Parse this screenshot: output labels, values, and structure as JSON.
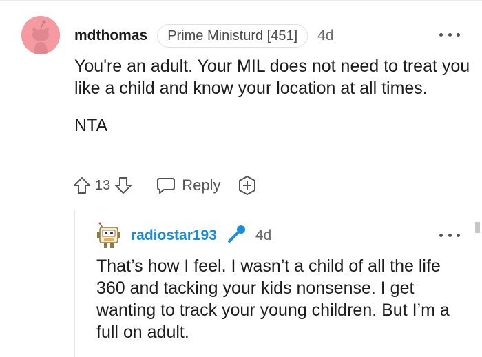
{
  "comment": {
    "author": "mdthomas",
    "flair": "Prime Ministurd [451]",
    "age": "4d",
    "paragraphs": [
      "You're an adult. Your MIL does not need to treat you like a child and know your location at all times.",
      "NTA"
    ],
    "vote_count": "13",
    "reply_label": "Reply",
    "icons": {
      "avatar": "snoo-avatar",
      "more": "more-options-icon",
      "upvote": "upvote-arrow-icon",
      "downvote": "downvote-arrow-icon",
      "reply": "speech-bubble-icon",
      "award": "award-plus-icon"
    },
    "avatar_bg": "#f59aa1"
  },
  "reply": {
    "author": "radiostar193",
    "age": "4d",
    "text": "That’s how I feel. I wasn’t a child of all the life 360 and tacking your kids nonsense. I get wanting to track your young children. But I’m a full on adult.",
    "author_color": "#1a8dd8",
    "icons": {
      "avatar": "radio-robot-avatar",
      "badge": "microphone-icon",
      "more": "more-options-icon"
    }
  }
}
